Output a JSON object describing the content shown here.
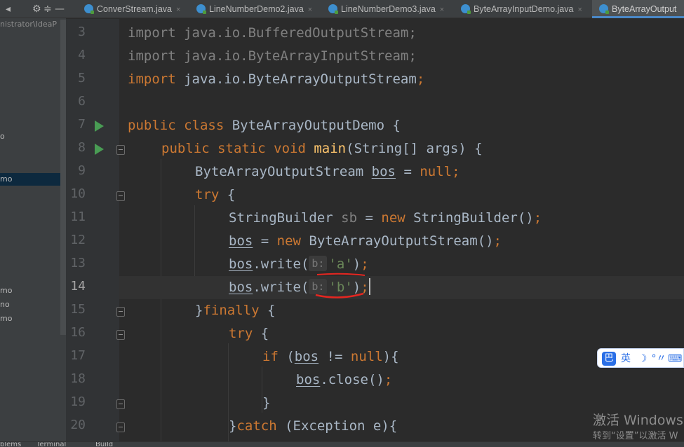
{
  "sidebar": {
    "path": "nistrator\\IdeaP",
    "items": [
      {
        "label": "o"
      },
      {
        "label": "mo"
      },
      {
        "label": "mo"
      },
      {
        "label": "no"
      },
      {
        "label": "mo"
      }
    ],
    "toolbar_icons": [
      "gear-icon",
      "collapse-icon",
      "minimize-icon"
    ]
  },
  "tabs": [
    {
      "label": "ConverStream.java"
    },
    {
      "label": "LineNumberDemo2.java"
    },
    {
      "label": "LineNumberDemo3.java"
    },
    {
      "label": "ByteArrayInputDemo.java"
    },
    {
      "label": "ByteArrayOutput"
    }
  ],
  "close_glyph": "×",
  "lines": [
    "3",
    "4",
    "5",
    "6",
    "7",
    "8",
    "9",
    "10",
    "11",
    "12",
    "13",
    "14",
    "15",
    "16",
    "17",
    "18",
    "19",
    "20"
  ],
  "code": {
    "l3": {
      "kw": "import",
      "rest": " java.io.BufferedOutputStream;"
    },
    "l4": {
      "kw": "import",
      "rest": " java.io.ByteArrayInputStream;"
    },
    "l5": {
      "kw": "import",
      "rest": " java.io.ByteArrayOutputStream",
      "semi": ";"
    },
    "l7": {
      "kw": "public class",
      "name": " ByteArrayOutputDemo {"
    },
    "l8": {
      "kw": "public static void",
      "fn": "main",
      "rest": "(String[] args) {"
    },
    "l9": {
      "type": "ByteArrayOutputStream ",
      "var": "bos",
      "eq": " = ",
      "kw": "null",
      "semi": ";"
    },
    "l10": {
      "kw": "try",
      "rest": " {"
    },
    "l11": {
      "type": "StringBuilder ",
      "var": "sb",
      "eq": " = ",
      "kw": "new",
      "rest": " StringBuilder()",
      "semi": ";"
    },
    "l12": {
      "var": "bos",
      "eq": " = ",
      "kw": "new",
      "rest": " ByteArrayOutputStream()",
      "semi": ";"
    },
    "l13": {
      "var": "bos",
      "call": ".write(",
      "hint": "b:",
      "str": "'a'",
      "close": ")",
      "semi": ";"
    },
    "l14": {
      "var": "bos",
      "call": ".write(",
      "hint": "b:",
      "str": "'b'",
      "close": ")",
      "semi": ";"
    },
    "l15": {
      "pre": "}",
      "kw": "finally",
      "rest": " {"
    },
    "l16": {
      "kw": "try",
      "rest": " {"
    },
    "l17": {
      "kw": "if",
      "open": " (",
      "var": "bos",
      "op": " != ",
      "kw2": "null",
      "rest": "){"
    },
    "l18": {
      "var": "bos",
      "rest": ".close()",
      "semi": ";"
    },
    "l19": {
      "rest": "}"
    },
    "l20": {
      "pre": "}",
      "kw": "catch",
      "rest": " (Exception e){"
    }
  },
  "ime": {
    "logo": "巴",
    "items": [
      "英",
      "☽",
      "°〃",
      "⌨"
    ]
  },
  "watermark": {
    "title": "激活 Windows",
    "subtitle": "转到“设置”以激活 W"
  },
  "bottom_bar": [
    "blems",
    "Terminal",
    "Build"
  ]
}
